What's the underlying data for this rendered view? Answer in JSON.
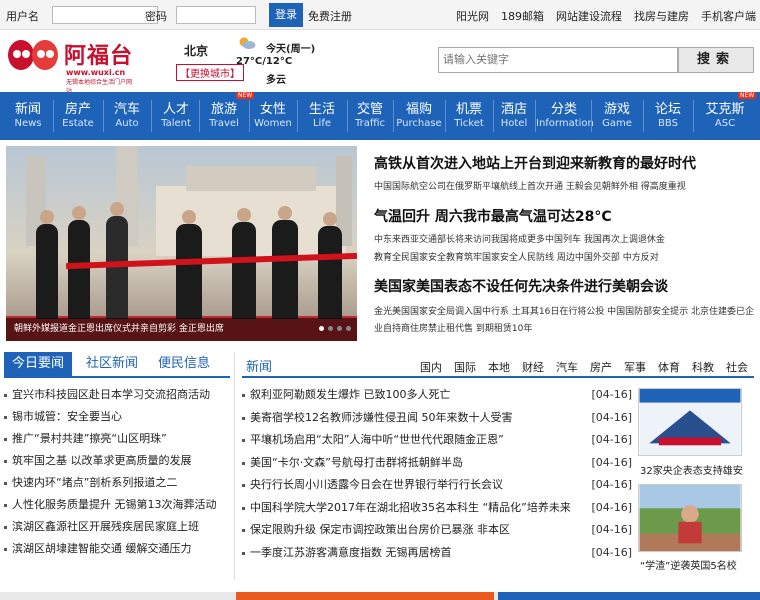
{
  "topbar": {
    "username_label": "用户名",
    "password_label": "密码",
    "login_label": "登录",
    "register_label": "免费注册",
    "links": [
      "阳光网",
      "189邮箱",
      "网站建设流程",
      "找房与建房",
      "手机客户端"
    ]
  },
  "header": {
    "brand_name": "阿福台",
    "brand_url": "www.wuxi.cn",
    "brand_sub": "无锡本地综合生活门户网站",
    "city": "北京",
    "switch_city": "【更换城市】",
    "weather": {
      "date": "今天(周一)",
      "temp": "27°C/12°C",
      "desc": "多云"
    },
    "search_placeholder": "请输入关键字",
    "search_button": "搜索"
  },
  "nav": [
    {
      "zh": "新闻",
      "en": "News"
    },
    {
      "zh": "房产",
      "en": "Estate"
    },
    {
      "zh": "汽车",
      "en": "Auto"
    },
    {
      "zh": "人才",
      "en": "Talent"
    },
    {
      "zh": "旅游",
      "en": "Travel"
    },
    {
      "zh": "女性",
      "en": "Women"
    },
    {
      "zh": "生活",
      "en": "Life"
    },
    {
      "zh": "交管",
      "en": "Traffic"
    },
    {
      "zh": "福购",
      "en": "Purchase"
    },
    {
      "zh": "机票",
      "en": "Ticket"
    },
    {
      "zh": "酒店",
      "en": "Hotel"
    },
    {
      "zh": "分类",
      "en": "Information"
    },
    {
      "zh": "游戏",
      "en": "Game"
    },
    {
      "zh": "论坛",
      "en": "BBS"
    },
    {
      "zh": "艾克斯",
      "en": "ASC"
    }
  ],
  "nav_badge": "NEW",
  "photo_caption": "朝鲜外媒报道金正恩出席仪式并亲自剪彩 金正恩出席",
  "headlines": [
    {
      "title": "高铁从首次进入地站上开台到迎来新教育的最好时代",
      "sub": "中国国际航空公司在俄罗斯平壤航线上首次开通 王毅会见朝鲜外相 得高度重视"
    },
    {
      "title": "气温回升 周六我市最高气温可达28°C",
      "sub": "中东来西亚交通部长将来访问我国将成更多中国列车 我国再次上调退休金"
    },
    {
      "title": "美国家美国表态不设任何先决条件进行美朝会谈",
      "sub": "教育全民国家安全教育筑牢国家安全人民防线 周边中国外交部 中方反对"
    },
    {
      "title": "",
      "sub": "金光美国国家安全局调入国中行系 土耳其16日在行将公投 中国国防部安全提示 北京住建委已企业自持商住房禁止租代售 到期租赁10年"
    }
  ],
  "left_tabs": [
    "今日要闻",
    "社区新闻",
    "便民信息"
  ],
  "left_list": [
    "宜兴市科技园区赴日本学习交流招商活动",
    "锡市城管：安全要当心",
    "推广“景村共建”擦亮“山区明珠”",
    "筑牢国之基 以改革求更高质量的发展",
    "快速内环“堵点”剖析系列报道之二",
    "人性化服务质量提升 无锡第13次海葬活动",
    "滨湖区鑫源社区开展残疾居民家庭上班",
    "滨湖区胡埭建智能交通 缓解交通压力"
  ],
  "mid": {
    "title": "新闻",
    "tabs": [
      "国内",
      "国际",
      "本地",
      "财经",
      "汽车",
      "房产",
      "军事",
      "体育",
      "科教",
      "社会"
    ],
    "items": [
      {
        "title": "叙利亚阿勒颇发生爆炸 已致100多人死亡",
        "date": "[04-16]"
      },
      {
        "title": "美寄宿学校12名教师涉嫌性侵丑闻 50年来数十人受害",
        "date": "[04-16]"
      },
      {
        "title": "平壤机场启用“太阳”人海中听“世世代代跟随金正恩”",
        "date": "[04-16]"
      },
      {
        "title": "美国“卡尔·文森”号航母打击群将抵朝鲜半岛",
        "date": "[04-16]"
      },
      {
        "title": "央行行长周小川透露今日会在世界银行举行行长会议",
        "date": "[04-16]"
      },
      {
        "title": "中国科学院大学2017年在湖北招收35名本科生 “精品化”培养未来科学家",
        "date": "[04-16]"
      },
      {
        "title": "保定限购升级 保定市调控政策出台房价已暴涨 非本区",
        "date": "[04-16]"
      },
      {
        "title": "一季度江苏游客满意度指数 无锡再居榜首",
        "date": "[04-16]"
      }
    ]
  },
  "right_ads": [
    {
      "caption": "32家央企表态支持雄安"
    },
    {
      "caption": "“学渣”逆袭英国5名校"
    }
  ],
  "colors": {
    "primary": "#1e63b8",
    "brand": "#c8102e"
  }
}
